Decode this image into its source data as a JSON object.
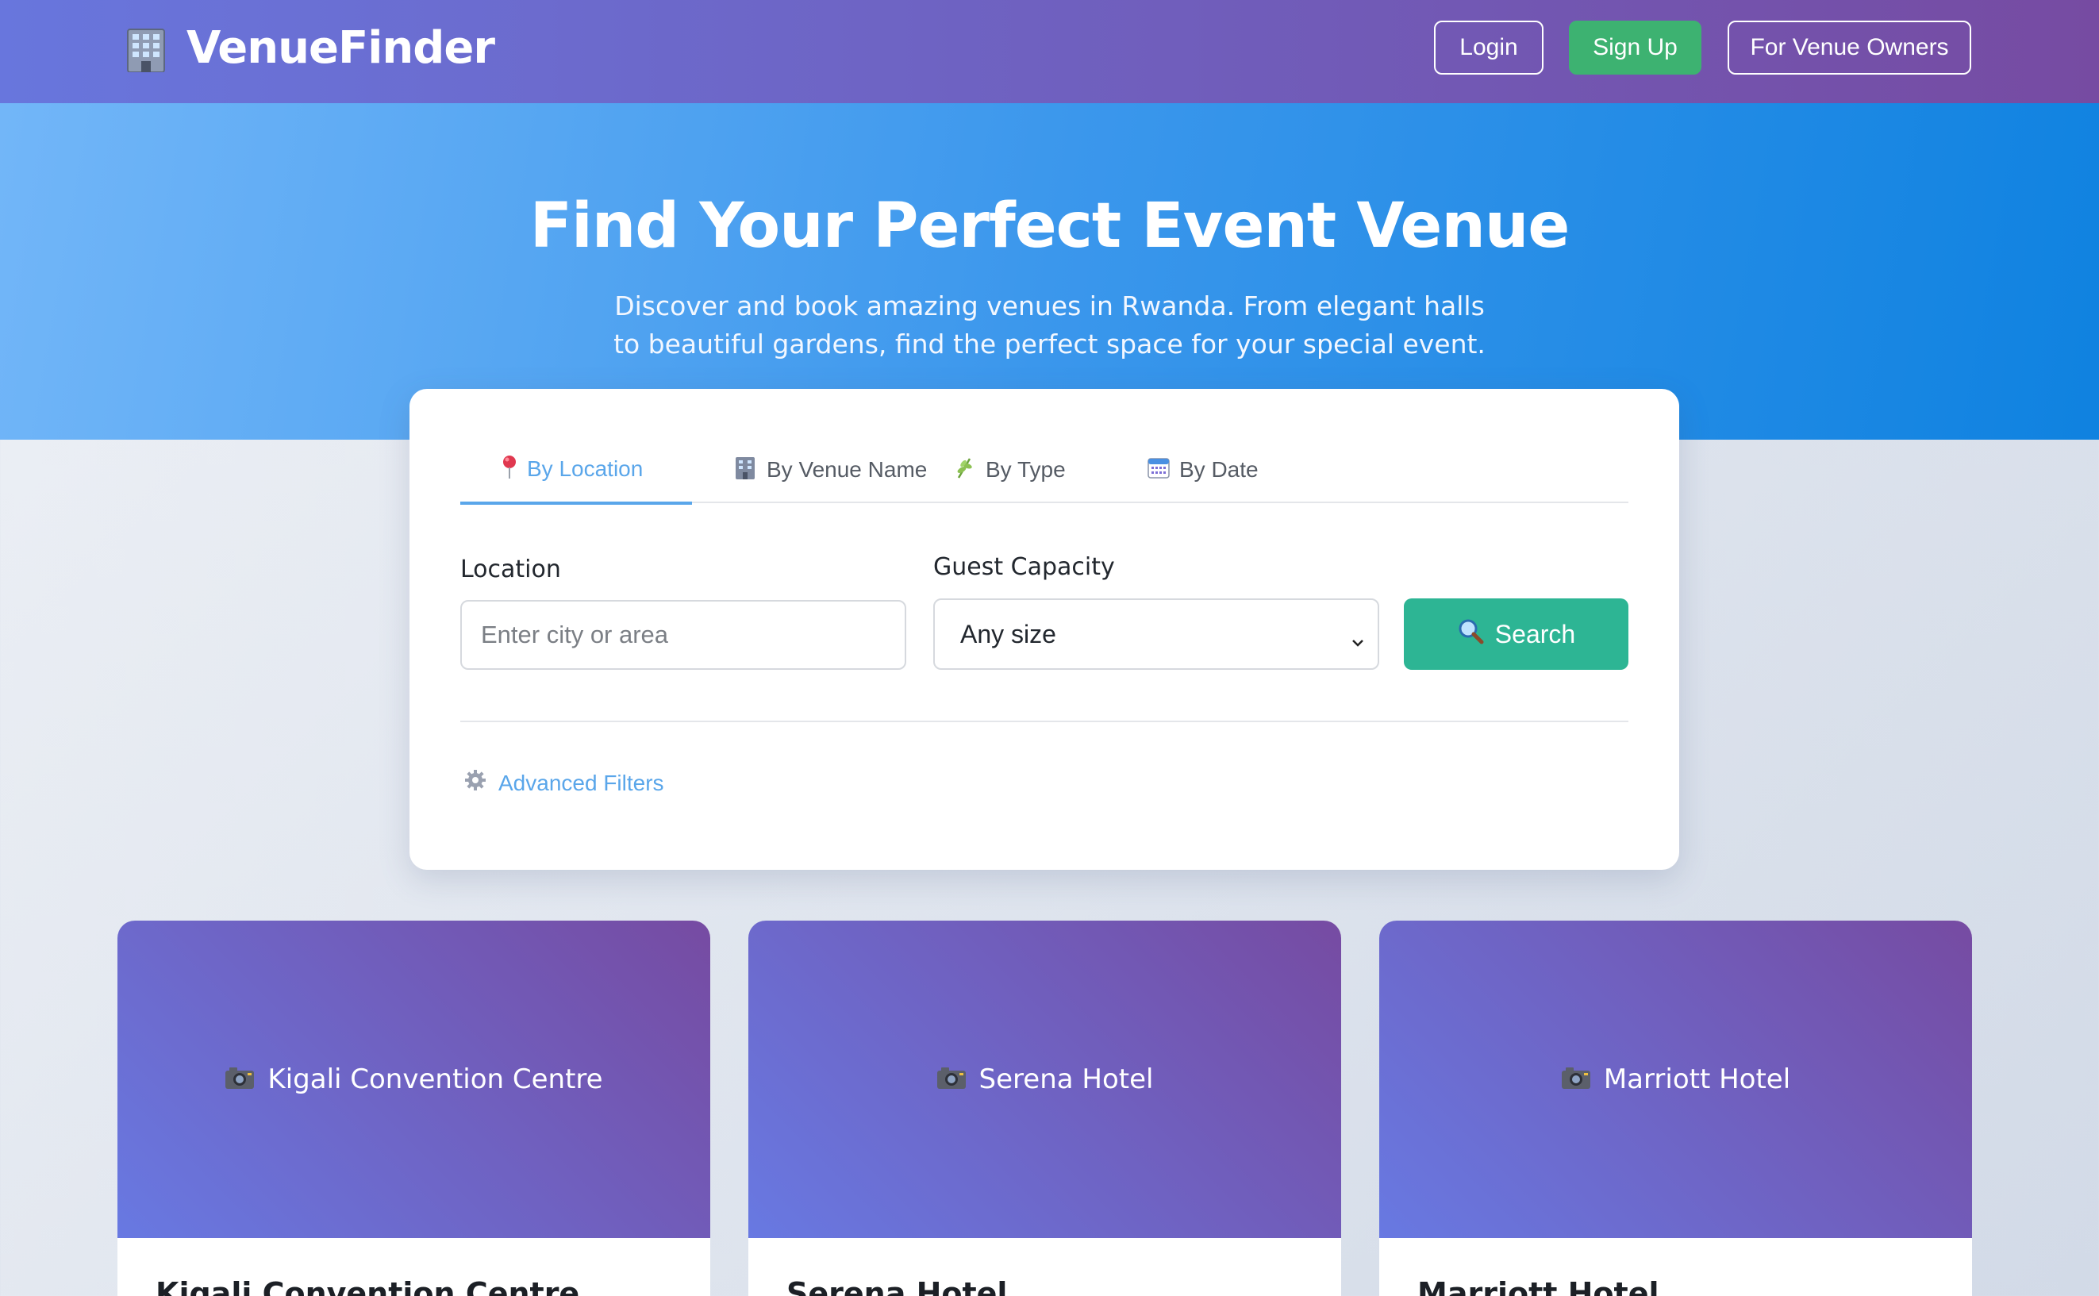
{
  "header": {
    "brand_name": "VenueFinder",
    "brand_icon": "office-building-icon",
    "login_label": "Login",
    "signup_label": "Sign Up",
    "owners_label": "For Venue Owners"
  },
  "hero": {
    "title": "Find Your Perfect Event Venue",
    "subtitle": "Discover and book amazing venues in Rwanda. From elegant halls to beautiful gardens, find the perfect space for your special event."
  },
  "search": {
    "tabs": [
      {
        "label": "By Location",
        "icon": "pin-icon",
        "active": true
      },
      {
        "label": "By Venue Name",
        "icon": "building-icon",
        "active": false
      },
      {
        "label": "By Type",
        "icon": "herb-icon",
        "active": false
      },
      {
        "label": "By Date",
        "icon": "calendar-icon",
        "active": false
      }
    ],
    "location_label": "Location",
    "location_placeholder": "Enter city or area",
    "location_value": "",
    "capacity_label": "Guest Capacity",
    "capacity_selected": "Any size",
    "search_button": "Search",
    "advanced_filters": "Advanced Filters"
  },
  "venues": [
    {
      "image_caption": "Kigali Convention Centre",
      "title": "Kigali Convention Centre"
    },
    {
      "image_caption": "Serena Hotel",
      "title": "Serena Hotel"
    },
    {
      "image_caption": "Marriott Hotel",
      "title": "Marriott Hotel"
    }
  ],
  "colors": {
    "header_gradient": [
      "#6876dd",
      "#764ba2"
    ],
    "hero_gradient": [
      "#72b6f8",
      "#0f82e0"
    ],
    "accent_blue": "#5aa6ea",
    "search_green": "#2db594",
    "signup_green": "#3db271"
  }
}
